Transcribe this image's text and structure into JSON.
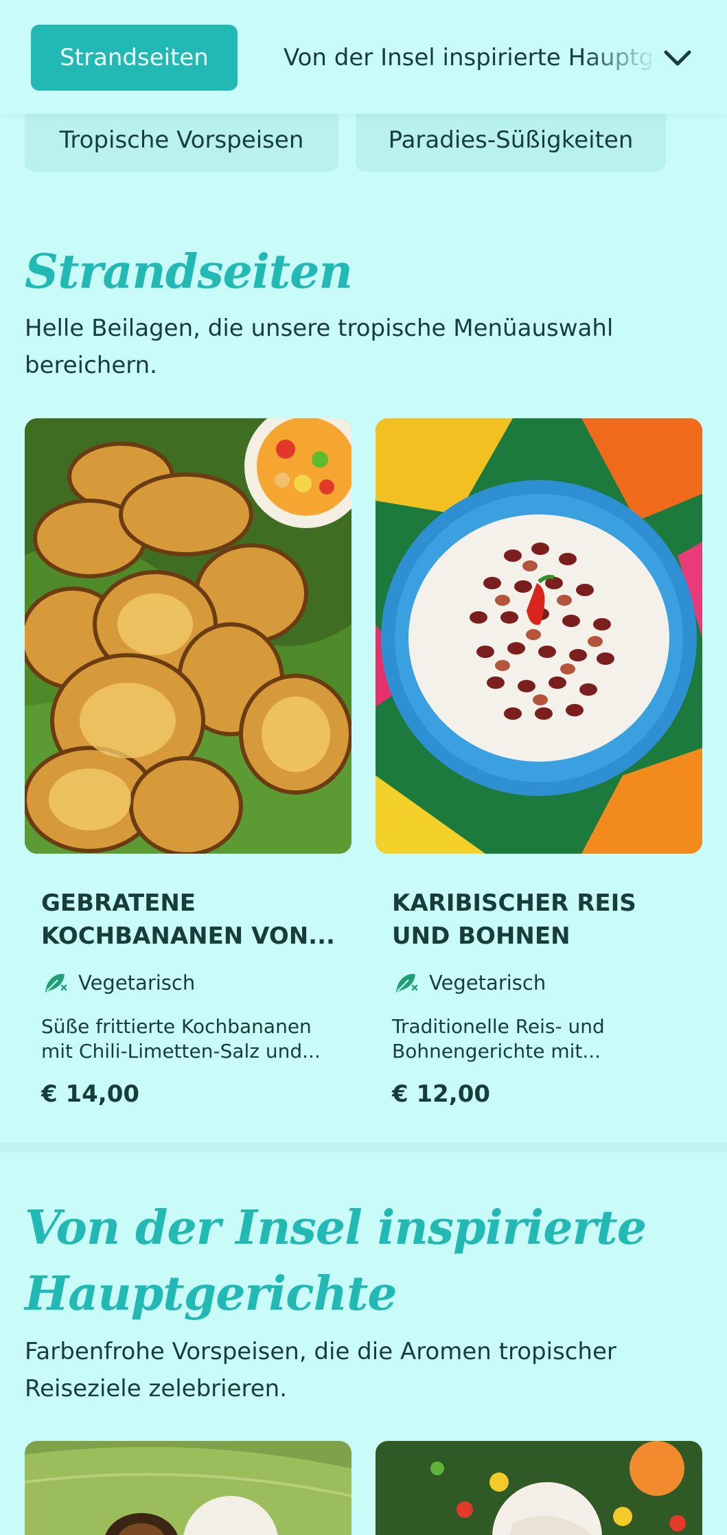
{
  "nav": {
    "active_tab": "Strandseiten",
    "next_tab": "Von der Insel inspirierte Hauptgerichte",
    "row2": [
      "Tropische Vorspeisen",
      "Paradies-Süßigkeiten"
    ]
  },
  "sections": [
    {
      "title": "Strandseiten",
      "description": "Helle Beilagen, die unsere tropische Menüauswahl bereichern.",
      "items": [
        {
          "name": "GEBRATENE KOCHBANANEN VON...",
          "diet": "Vegetarisch",
          "description_line1": "Süße frittierte Kochbananen",
          "description_line2": "mit Chili-Limetten-Salz und...",
          "price": "€ 14,00"
        },
        {
          "name": "KARIBISCHER REIS UND BOHNEN",
          "diet": "Vegetarisch",
          "description_line1": "Traditionelle Reis- und",
          "description_line2": "Bohnengerichte mit...",
          "price": "€ 12,00"
        }
      ]
    },
    {
      "title_line1": "Von der Insel inspirierte",
      "title_line2": "Hauptgerichte",
      "description": "Farbenfrohe Vorspeisen, die die Aromen tropischer Reiseziele zelebrieren."
    }
  ],
  "colors": {
    "accent": "#22b8b3",
    "background": "#c9fbf8",
    "text": "#173d3b"
  },
  "icons": {
    "expand": "chevron-down-icon",
    "diet": "leaf-icon"
  }
}
